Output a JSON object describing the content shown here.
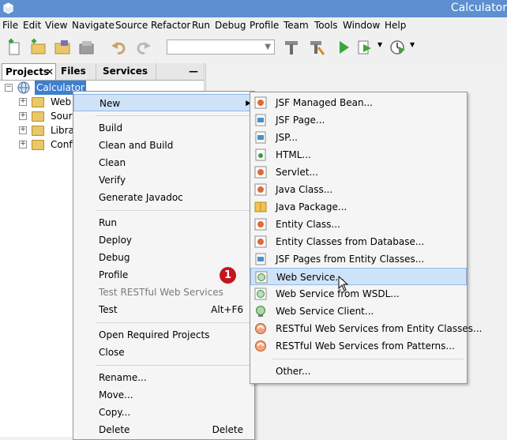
{
  "window": {
    "title": "Calculator"
  },
  "menubar": [
    "File",
    "Edit",
    "View",
    "Navigate",
    "Source",
    "Refactor",
    "Run",
    "Debug",
    "Profile",
    "Team",
    "Tools",
    "Window",
    "Help"
  ],
  "toolbar": {
    "icons": [
      "new-file-icon",
      "new-project-icon",
      "open-project-icon",
      "close-project-icon",
      "undo-icon",
      "redo-icon",
      "build-icon",
      "clean-build-icon",
      "run-icon",
      "debug-icon",
      "profile-icon"
    ],
    "config_value": ""
  },
  "tabs": {
    "projects": "Projects",
    "files": "Files",
    "services": "Services"
  },
  "tree": {
    "root": "Calculator",
    "children": [
      "Web Pages",
      "Source Packages",
      "Libraries",
      "Configuration Files"
    ]
  },
  "context_menu": {
    "items": [
      {
        "label": "New",
        "accel": "",
        "submenu": true
      },
      {
        "label": "Build",
        "accel": ""
      },
      {
        "label": "Clean and Build",
        "accel": ""
      },
      {
        "label": "Clean",
        "accel": ""
      },
      {
        "label": "Verify",
        "accel": ""
      },
      {
        "label": "Generate Javadoc",
        "accel": ""
      },
      {
        "label": "Run",
        "accel": ""
      },
      {
        "label": "Deploy",
        "accel": ""
      },
      {
        "label": "Debug",
        "accel": ""
      },
      {
        "label": "Profile",
        "accel": ""
      },
      {
        "label": "Test RESTful Web Services",
        "accel": "",
        "disabled": true
      },
      {
        "label": "Test",
        "accel": "Alt+F6"
      },
      {
        "label": "Open Required Projects",
        "accel": ""
      },
      {
        "label": "Close",
        "accel": ""
      },
      {
        "label": "Rename...",
        "accel": ""
      },
      {
        "label": "Move...",
        "accel": ""
      },
      {
        "label": "Copy...",
        "accel": ""
      },
      {
        "label": "Delete",
        "accel": "Delete"
      }
    ]
  },
  "submenu": {
    "items": [
      {
        "label": "JSF Managed Bean...",
        "icon": "jsf-bean-icon"
      },
      {
        "label": "JSF Page...",
        "icon": "jsf-page-icon"
      },
      {
        "label": "JSP...",
        "icon": "jsp-icon"
      },
      {
        "label": "HTML...",
        "icon": "html-icon"
      },
      {
        "label": "Servlet...",
        "icon": "servlet-icon"
      },
      {
        "label": "Java Class...",
        "icon": "java-class-icon"
      },
      {
        "label": "Java Package...",
        "icon": "java-package-icon"
      },
      {
        "label": "Entity Class...",
        "icon": "entity-class-icon"
      },
      {
        "label": "Entity Classes from Database...",
        "icon": "entity-db-icon"
      },
      {
        "label": "JSF Pages from Entity Classes...",
        "icon": "jsf-pages-icon"
      },
      {
        "label": "Web Service...",
        "icon": "web-service-icon",
        "highlighted": true
      },
      {
        "label": "Web Service from WSDL...",
        "icon": "wsdl-icon"
      },
      {
        "label": "Web Service Client...",
        "icon": "ws-client-icon"
      },
      {
        "label": "RESTful Web Services from Entity Classes...",
        "icon": "rest-entity-icon"
      },
      {
        "label": "RESTful Web Services from Patterns...",
        "icon": "rest-patterns-icon"
      },
      {
        "label": "Other...",
        "icon": ""
      }
    ]
  },
  "annotation": {
    "step": "1"
  },
  "colors": {
    "titlebar": "#5d8fd1",
    "highlight": "#cfe3f8",
    "badge": "#c4161c"
  }
}
